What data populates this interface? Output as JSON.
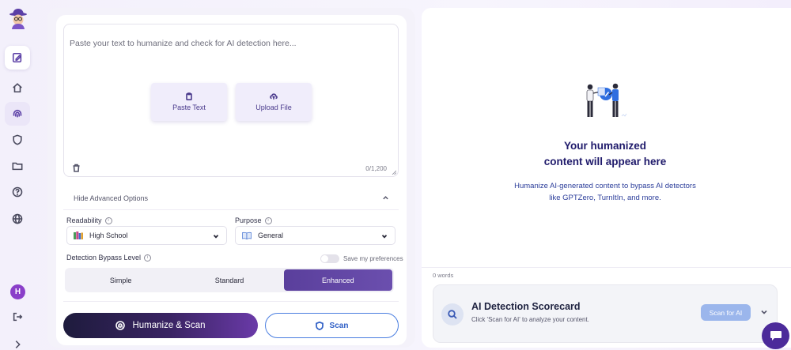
{
  "input": {
    "placeholder": "Paste your text to humanize and check for AI detection here...",
    "paste_label": "Paste Text",
    "upload_label": "Upload File",
    "counter": "0/1,200"
  },
  "advanced": {
    "toggle_label": "Hide Advanced Options"
  },
  "readability": {
    "label": "Readability",
    "value": "High School"
  },
  "purpose": {
    "label": "Purpose",
    "value": "General"
  },
  "bypass": {
    "label": "Detection Bypass Level",
    "save_prefs_label": "Save my preferences",
    "options": [
      "Simple",
      "Standard",
      "Enhanced"
    ],
    "selected": "Enhanced"
  },
  "actions": {
    "humanize_label": "Humanize & Scan",
    "scan_label": "Scan"
  },
  "output": {
    "title_line1": "Your humanized",
    "title_line2": "content will appear here",
    "desc": "Humanize AI-generated content to bypass AI detectors like GPTZero, TurnItIn, and more.",
    "word_count": "0 words"
  },
  "scorecard": {
    "title": "AI Detection Scorecard",
    "subtitle": "Click 'Scan for AI' to analyze your content.",
    "button_label": "Scan for AI"
  },
  "user": {
    "avatar_initial": "H"
  },
  "colors": {
    "accent": "#5a3f9c",
    "title": "#1f1a6b",
    "scan_blue": "#2f5fc6"
  }
}
